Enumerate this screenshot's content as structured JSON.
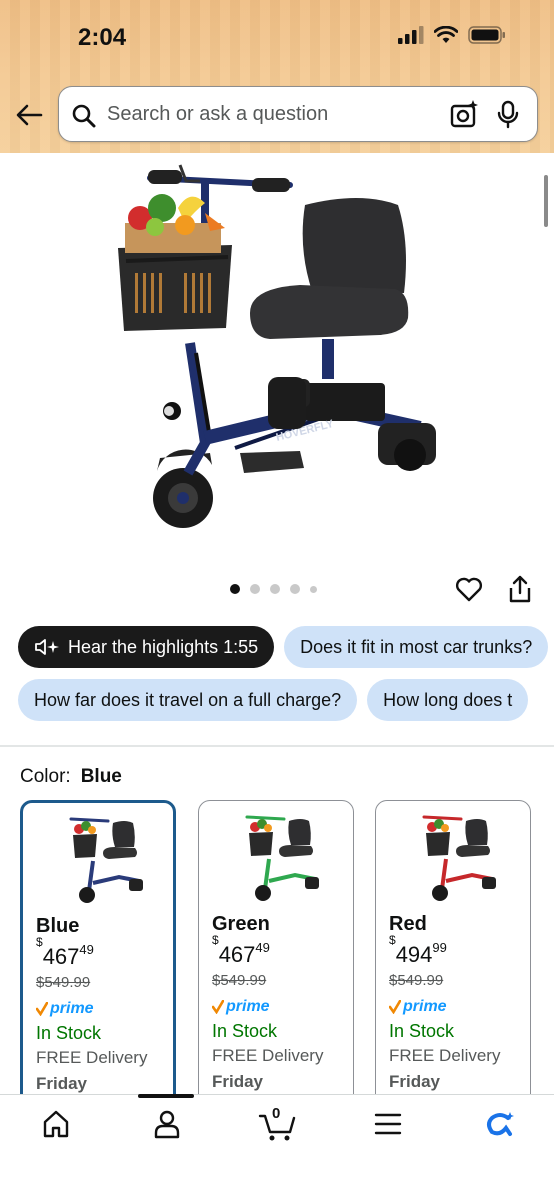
{
  "status_bar": {
    "time": "2:04"
  },
  "search": {
    "placeholder": "Search or ask a question"
  },
  "icons": {
    "back": "back-arrow-icon",
    "search": "search-icon",
    "camera": "camera-ai-icon",
    "mic": "mic-icon",
    "heart": "heart-icon",
    "share": "share-icon"
  },
  "gallery": {
    "image_count": 5,
    "active_index": 0,
    "product_brand_mark": "HOVERFLY"
  },
  "chips_row1": [
    {
      "label": "Hear the highlights 1:55"
    },
    {
      "label": "Does it fit in most car trunks?"
    }
  ],
  "chips_row2": [
    {
      "label": "How far does it travel on a full charge?"
    },
    {
      "label": "How long does t"
    }
  ],
  "color": {
    "label": "Color:",
    "selected": "Blue"
  },
  "variants": [
    {
      "name": "Blue",
      "currency": "$",
      "price_whole": "467",
      "price_cents": "49",
      "list_price": "$549.99",
      "prime": "prime",
      "stock": "In Stock",
      "delivery": "FREE Delivery",
      "day": "Friday",
      "accent": "#2a3b7a"
    },
    {
      "name": "Green",
      "currency": "$",
      "price_whole": "467",
      "price_cents": "49",
      "list_price": "$549.99",
      "prime": "prime",
      "stock": "In Stock",
      "delivery": "FREE Delivery",
      "day": "Friday",
      "accent": "#2fa84f"
    },
    {
      "name": "Red",
      "currency": "$",
      "price_whole": "494",
      "price_cents": "99",
      "list_price": "$549.99",
      "prime": "prime",
      "stock": "In Stock",
      "delivery": "FREE Delivery",
      "day": "Friday",
      "accent": "#c6282b"
    }
  ],
  "bottom_nav": {
    "items": [
      "home-icon",
      "account-icon",
      "cart-icon",
      "menu-icon",
      "rufus-icon"
    ],
    "cart_count": "0"
  },
  "colors": {
    "prime_blue": "#1399ff",
    "stock_green": "#007600",
    "chip_blue": "#cfe2f8",
    "selected_border": "#1d5a8c"
  }
}
